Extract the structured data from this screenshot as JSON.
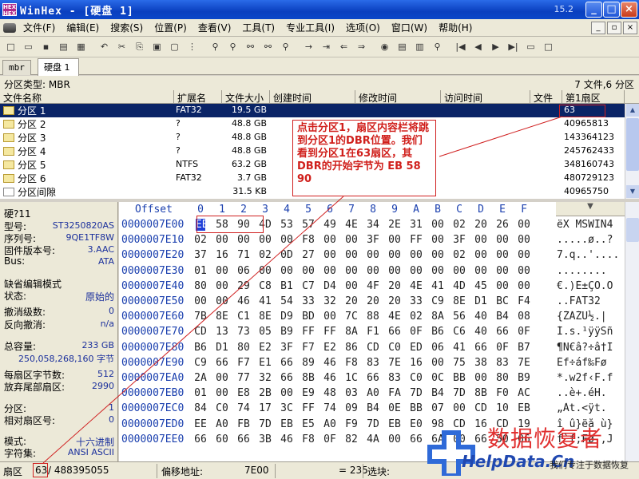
{
  "window": {
    "title": "WinHex - [硬盘 1]",
    "version": "15.2",
    "controls": [
      "_",
      "□",
      "×"
    ]
  },
  "menu": [
    "文件(F)",
    "编辑(E)",
    "搜索(S)",
    "位置(P)",
    "查看(V)",
    "工具(T)",
    "专业工具(I)",
    "选项(O)",
    "窗口(W)",
    "帮助(H)"
  ],
  "tabs": [
    "mbr",
    "硬盘 1"
  ],
  "partition_bar": {
    "type_label": "分区类型: MBR",
    "summary": "7 文件,6 分区"
  },
  "dir_columns": [
    "文件名称",
    "扩展名",
    "文件大小",
    "创建时间",
    "修改时间",
    "访问时间",
    "文件",
    "第1扇区"
  ],
  "dir_rows": [
    {
      "name": "分区 1",
      "ext": "FAT32",
      "size": "19.5 GB",
      "sector": "63"
    },
    {
      "name": "分区 2",
      "ext": "?",
      "size": "48.8 GB",
      "sector": "40965813"
    },
    {
      "name": "分区 3",
      "ext": "?",
      "size": "48.8 GB",
      "sector": "143364123"
    },
    {
      "name": "分区 4",
      "ext": "?",
      "size": "48.8 GB",
      "sector": "245762433"
    },
    {
      "name": "分区 5",
      "ext": "NTFS",
      "size": "63.2 GB",
      "sector": "348160743"
    },
    {
      "name": "分区 6",
      "ext": "FAT32",
      "size": "3.7 GB",
      "sector": "480729123"
    },
    {
      "name": "分区间隙",
      "ext": "",
      "size": "31.5 KB",
      "sector": "40965750"
    }
  ],
  "info_panel": {
    "disk_label": "硬?11",
    "model_k": "型号:",
    "model_v": "ST3250820AS",
    "serial_k": "序列号:",
    "serial_v": "9QE1TF8W",
    "firmware_k": "固件版本号:",
    "firmware_v": "3.AAC",
    "bus_k": "Bus:",
    "bus_v": "ATA",
    "edit_mode_k": "缺省编辑模式",
    "state_k": "状态:",
    "state_v": "原始的",
    "undo_k": "撤消级数:",
    "undo_v": "0",
    "redo_k": "反向撤消:",
    "redo_v": "n/a",
    "capacity_k": "总容量:",
    "capacity_v": "233 GB",
    "capacity_bytes": "250,058,268,160 字节",
    "bps_k": "每扇区字节数:",
    "bps_v": "512",
    "spare_k": "放弃尾部扇区:",
    "spare_v": "2990",
    "partition_k": "分区:",
    "partition_v": "1",
    "relsec_k": "相对扇区号:",
    "relsec_v": "0",
    "mode_k": "模式:",
    "mode_v": "十六进制",
    "charset_k": "字符集:",
    "charset_v": "ANSI ASCII"
  },
  "hex_header": {
    "offset_label": "Offset",
    "cols": [
      "0",
      "1",
      "2",
      "3",
      "4",
      "5",
      "6",
      "7",
      "8",
      "9",
      "A",
      "B",
      "C",
      "D",
      "E",
      "F"
    ]
  },
  "hex_rows": [
    {
      "off": "0000007E00",
      "bytes": [
        "EB",
        "58",
        "90",
        "4D",
        "53",
        "57",
        "49",
        "4E",
        "34",
        "2E",
        "31",
        "00",
        "02",
        "20",
        "26",
        "00"
      ],
      "ascii": "ëX MSWIN4"
    },
    {
      "off": "0000007E10",
      "bytes": [
        "02",
        "00",
        "00",
        "00",
        "00",
        "F8",
        "00",
        "00",
        "3F",
        "00",
        "FF",
        "00",
        "3F",
        "00",
        "00",
        "00"
      ],
      "ascii": ".....ø..?"
    },
    {
      "off": "0000007E20",
      "bytes": [
        "37",
        "16",
        "71",
        "02",
        "0D",
        "27",
        "00",
        "00",
        "00",
        "00",
        "00",
        "00",
        "02",
        "00",
        "00",
        "00"
      ],
      "ascii": "7.q..'...."
    },
    {
      "off": "0000007E30",
      "bytes": [
        "01",
        "00",
        "06",
        "00",
        "00",
        "00",
        "00",
        "00",
        "00",
        "00",
        "00",
        "00",
        "00",
        "00",
        "00",
        "00"
      ],
      "ascii": "........"
    },
    {
      "off": "0000007E40",
      "bytes": [
        "80",
        "00",
        "29",
        "C8",
        "B1",
        "C7",
        "D4",
        "00",
        "4F",
        "20",
        "4E",
        "41",
        "4D",
        "45",
        "00",
        "00"
      ],
      "ascii": "€.)È±ÇÔ.O"
    },
    {
      "off": "0000007E50",
      "bytes": [
        "00",
        "00",
        "46",
        "41",
        "54",
        "33",
        "32",
        "20",
        "20",
        "20",
        "33",
        "C9",
        "8E",
        "D1",
        "BC",
        "F4"
      ],
      "ascii": "..FAT32"
    },
    {
      "off": "0000007E60",
      "bytes": [
        "7B",
        "8E",
        "C1",
        "8E",
        "D9",
        "BD",
        "00",
        "7C",
        "88",
        "4E",
        "02",
        "8A",
        "56",
        "40",
        "B4",
        "08"
      ],
      "ascii": "{ŽÁŽÙ½.|"
    },
    {
      "off": "0000007E70",
      "bytes": [
        "CD",
        "13",
        "73",
        "05",
        "B9",
        "FF",
        "FF",
        "8A",
        "F1",
        "66",
        "0F",
        "B6",
        "C6",
        "40",
        "66",
        "0F"
      ],
      "ascii": "Í.s.¹ÿÿŠñ"
    },
    {
      "off": "0000007E80",
      "bytes": [
        "B6",
        "D1",
        "80",
        "E2",
        "3F",
        "F7",
        "E2",
        "86",
        "CD",
        "C0",
        "ED",
        "06",
        "41",
        "66",
        "0F",
        "B7"
      ],
      "ascii": "¶Ñ€â?÷â†Í"
    },
    {
      "off": "0000007E90",
      "bytes": [
        "C9",
        "66",
        "F7",
        "E1",
        "66",
        "89",
        "46",
        "F8",
        "83",
        "7E",
        "16",
        "00",
        "75",
        "38",
        "83",
        "7E"
      ],
      "ascii": "Éf÷áf‰Fø"
    },
    {
      "off": "0000007EA0",
      "bytes": [
        "2A",
        "00",
        "77",
        "32",
        "66",
        "8B",
        "46",
        "1C",
        "66",
        "83",
        "C0",
        "0C",
        "BB",
        "00",
        "80",
        "B9"
      ],
      "ascii": "*.w2f‹F.f"
    },
    {
      "off": "0000007EB0",
      "bytes": [
        "01",
        "00",
        "E8",
        "2B",
        "00",
        "E9",
        "48",
        "03",
        "A0",
        "FA",
        "7D",
        "B4",
        "7D",
        "8B",
        "F0",
        "AC"
      ],
      "ascii": "..è+.éH."
    },
    {
      "off": "0000007EC0",
      "bytes": [
        "84",
        "C0",
        "74",
        "17",
        "3C",
        "FF",
        "74",
        "09",
        "B4",
        "0E",
        "BB",
        "07",
        "00",
        "CD",
        "10",
        "EB"
      ],
      "ascii": "„Àt.<ÿt."
    },
    {
      "off": "0000007ED0",
      "bytes": [
        "EE",
        "A0",
        "FB",
        "7D",
        "EB",
        "E5",
        "A0",
        "F9",
        "7D",
        "EB",
        "E0",
        "98",
        "CD",
        "16",
        "CD",
        "19"
      ],
      "ascii": "î û}ëå ù}"
    },
    {
      "off": "0000007EE0",
      "bytes": [
        "66",
        "60",
        "66",
        "3B",
        "46",
        "F8",
        "0F",
        "82",
        "4A",
        "00",
        "66",
        "6A",
        "00",
        "66",
        "50",
        "06"
      ],
      "ascii": "f`f;Fø.‚J"
    }
  ],
  "status": {
    "sector_label": "扇区",
    "sector_value": "63",
    "sector_total": "/ 488395055",
    "offset_label": "偏移地址:",
    "offset_value": "7E00",
    "value_text": "= 235",
    "block_label": "选块:"
  },
  "annotation": "点击分区1，扇区内容栏将跳到分区1的DBR位置。我们看到分区1在63扇区，其DBR的开始字节为 EB 58 90",
  "watermark": {
    "cn": "数据恢复者",
    "site": "HelpData.Cn",
    "slogan": "我们专注于数据恢复"
  },
  "colors": {
    "title_bar": "#0a3fbf",
    "selection": "#0a2466",
    "hex_offset": "#1a3fae",
    "annotation": "#d0201c",
    "cursor": "#1f3fd8"
  }
}
